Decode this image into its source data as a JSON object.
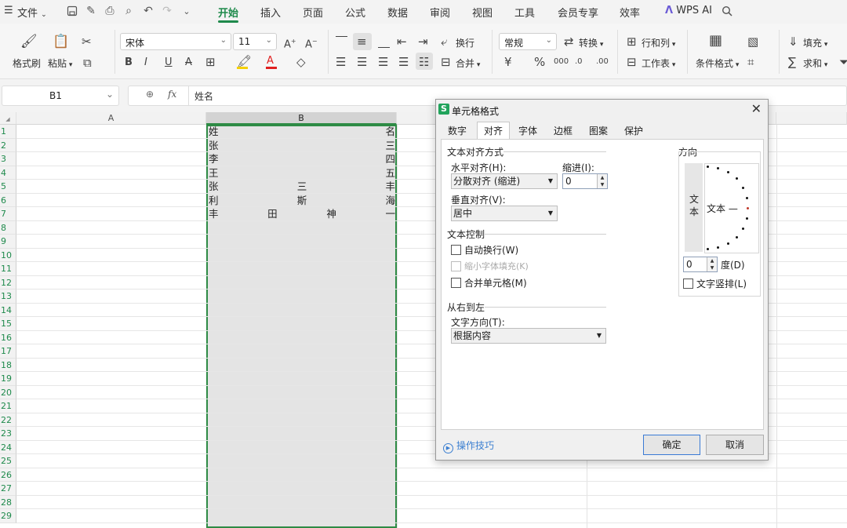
{
  "menu": {
    "file_label": "文件",
    "tabs": [
      "开始",
      "插入",
      "页面",
      "公式",
      "数据",
      "审阅",
      "视图",
      "工具",
      "会员专享",
      "效率"
    ],
    "wps_ai": "WPS AI"
  },
  "ribbon": {
    "format_painter": "格式刷",
    "paste": "粘贴",
    "font_name": "宋体",
    "font_size": "11",
    "wrap": "换行",
    "number_format": "常规",
    "convert": "转换",
    "row_col": "行和列",
    "merge": "合并",
    "worksheet": "工作表",
    "conditional_format": "条件格式",
    "fill": "填充",
    "sum": "求和"
  },
  "formula_bar": {
    "name_box": "B1",
    "fx": "fx",
    "content": "姓名"
  },
  "sheet": {
    "columns": [
      "A",
      "B"
    ],
    "rows": [
      "1",
      "2",
      "3",
      "4",
      "5",
      "6",
      "7",
      "8",
      "9",
      "10",
      "11",
      "12",
      "13",
      "14",
      "15",
      "16",
      "17",
      "18",
      "19",
      "20",
      "21",
      "22",
      "23",
      "24",
      "25",
      "26",
      "27",
      "28",
      "29"
    ],
    "cells_b": [
      [
        "姓",
        "名"
      ],
      [
        "张",
        "三"
      ],
      [
        "李",
        "四"
      ],
      [
        "王",
        "五"
      ],
      [
        "张",
        "三",
        "丰"
      ],
      [
        "利",
        "斯",
        "海"
      ],
      [
        "丰",
        "田",
        "神",
        "一"
      ]
    ]
  },
  "dialog": {
    "title": "单元格格式",
    "logo": "S",
    "close": "✕",
    "tabs": [
      "数字",
      "对齐",
      "字体",
      "边框",
      "图案",
      "保护"
    ],
    "active_tab": "对齐",
    "text_align_group": "文本对齐方式",
    "horizontal_label": "水平对齐(H):",
    "horizontal_value": "分散对齐 (缩进)",
    "indent_label": "缩进(I):",
    "indent_value": "0",
    "vertical_label": "垂直对齐(V):",
    "vertical_value": "居中",
    "text_control_group": "文本控制",
    "wrap_text": "自动换行(W)",
    "shrink_to_fit": "缩小字体填充(K)",
    "merge_cells": "合并单元格(M)",
    "rtl_group": "从右到左",
    "direction_label": "文字方向(T):",
    "direction_value": "根据内容",
    "orientation_group": "方向",
    "vertical_text": "文本",
    "arc_text": "文本 —",
    "degree_value": "0",
    "degree_label": "度(D)",
    "stacked_text": "文字竖排(L)",
    "tips": "操作技巧",
    "ok": "确定",
    "cancel": "取消"
  },
  "colors": {
    "accent": "#1f8a4c",
    "selection_border": "#2e8b45",
    "link": "#3b7fd1",
    "font_color_red": "#e02020",
    "highlight_yellow": "#f5d000"
  }
}
